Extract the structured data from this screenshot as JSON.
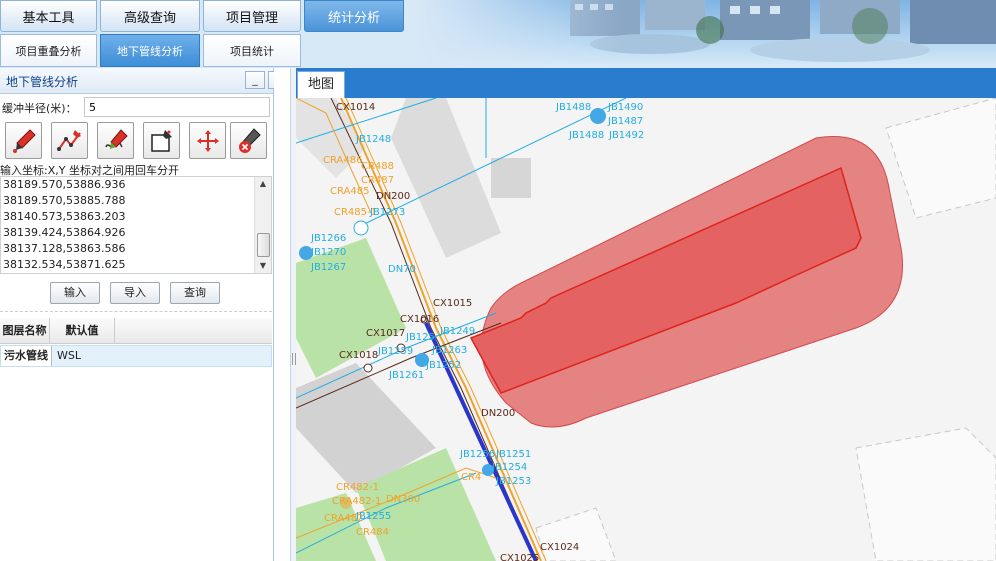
{
  "top_tabs": [
    {
      "label": "基本工具",
      "active": false
    },
    {
      "label": "高级查询",
      "active": false
    },
    {
      "label": "项目管理",
      "active": false
    },
    {
      "label": "统计分析",
      "active": true
    }
  ],
  "sub_tabs": [
    {
      "label": "项目重叠分析",
      "active": false
    },
    {
      "label": "地下管线分析",
      "active": true
    },
    {
      "label": "项目统计",
      "active": false
    }
  ],
  "panel": {
    "title": "地下管线分析",
    "minimize_label": "_",
    "close_label": "×",
    "buffer_label": "缓冲半径(米)：",
    "buffer_value": "5",
    "tool_icons": [
      "draw-point-icon",
      "draw-polyline-icon",
      "draw-freehand-icon",
      "draw-rectangle-icon",
      "pan-move-icon",
      "clear-graphics-icon"
    ],
    "coord_hint": "输入坐标:X,Y 坐标对之间用回车分开",
    "coordinates": [
      "38189.570,53886.936",
      "38189.570,53885.788",
      "38140.573,53863.203",
      "38139.424,53864.926",
      "38137.128,53863.586",
      "38132.534,53871.625"
    ],
    "buttons": {
      "input": "输入",
      "import": "导入",
      "query": "查询"
    },
    "grid": {
      "headers": [
        "图层名称",
        "默认值"
      ],
      "rows": [
        [
          "污水管线",
          "WSL"
        ]
      ]
    }
  },
  "map": {
    "tab_label": "地图",
    "labels": [
      "CX1014",
      "JB1488",
      "JB1490",
      "JB1487",
      "JB1488",
      "JB1492",
      "JB1248",
      "CRA486",
      "CR488",
      "CR487",
      "CRA485",
      "DN200",
      "CR485-1",
      "JB1273",
      "JB1266",
      "JB1270",
      "JB1267",
      "DN70",
      "CX1015",
      "CX1016",
      "CX1017",
      "JB1249",
      "JB125",
      "CX1018",
      "JB1259",
      "JB1263",
      "JB1252",
      "JB1261",
      "DN200",
      "JB1256",
      "JB1251",
      "JB1254",
      "CR4",
      "JB1253",
      "CR482-1",
      "CRA482-1",
      "DN300",
      "JB1255",
      "CRA482",
      "CR484",
      "CX1024",
      "CX1025"
    ],
    "colors": {
      "buffer_fill": "#e26f6f",
      "polygon_stroke": "#e0231b",
      "pipe_blue": "#2a36c9",
      "cyan_line": "#22aee2",
      "orange_line": "#f0a22a",
      "brown_line": "#5a2a1a"
    }
  }
}
